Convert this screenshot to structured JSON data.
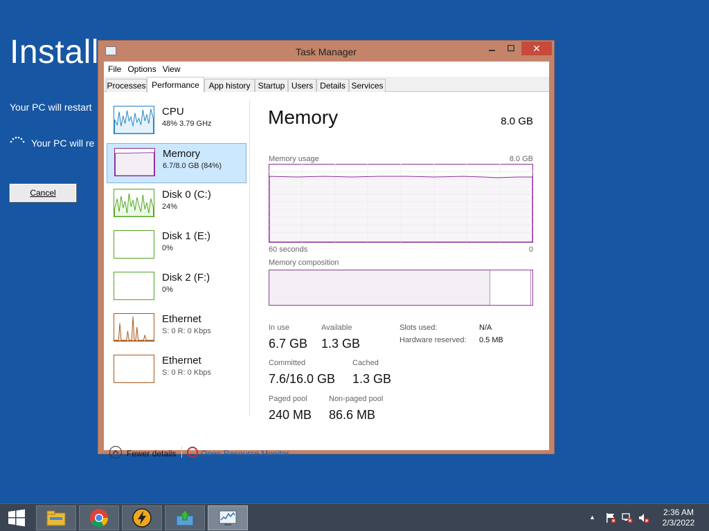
{
  "installer": {
    "title": "Install",
    "line1": "Your PC will restart",
    "line2": "Your PC will re",
    "cancel_label": "Cancel"
  },
  "window": {
    "title": "Task Manager",
    "close_glyph": "✕"
  },
  "menu": [
    "File",
    "Options",
    "View"
  ],
  "tabs": [
    {
      "label": "Processes",
      "active": false
    },
    {
      "label": "Performance",
      "active": true
    },
    {
      "label": "App history",
      "active": false
    },
    {
      "label": "Startup",
      "active": false
    },
    {
      "label": "Users",
      "active": false
    },
    {
      "label": "Details",
      "active": false
    },
    {
      "label": "Services",
      "active": false
    }
  ],
  "perf_list": [
    {
      "name": "CPU",
      "sub": "48% 3.79 GHz",
      "color": "#1b82c5"
    },
    {
      "name": "Memory",
      "sub": "6.7/8.0 GB (84%)",
      "color": "#8b2a9b"
    },
    {
      "name": "Disk 0 (C:)",
      "sub": "24%",
      "color": "#4da41c"
    },
    {
      "name": "Disk 1 (E:)",
      "sub": "0%",
      "color": "#4da41c"
    },
    {
      "name": "Disk 2 (F:)",
      "sub": "0%",
      "color": "#4da41c"
    },
    {
      "name": "Ethernet",
      "sub": "S: 0  R: 0 Kbps",
      "color": "#a7571b"
    },
    {
      "name": "Ethernet",
      "sub": "S: 0  R: 0 Kbps",
      "color": "#a7571b"
    }
  ],
  "memory": {
    "title": "Memory",
    "total": "8.0 GB",
    "usage_label": "Memory usage",
    "usage_max": "8.0 GB",
    "time_label": "60 seconds",
    "time_min": "0",
    "composition_label": "Memory composition",
    "in_use_fraction": 0.84,
    "stats": {
      "in_use_label": "In use",
      "in_use": "6.7 GB",
      "available_label": "Available",
      "available": "1.3 GB",
      "committed_label": "Committed",
      "committed": "7.6/16.0 GB",
      "cached_label": "Cached",
      "cached": "1.3 GB",
      "paged_label": "Paged pool",
      "paged": "240 MB",
      "nonpaged_label": "Non-paged pool",
      "nonpaged": "86.6 MB",
      "slots_label": "Slots used:",
      "slots": "N/A",
      "hwres_label": "Hardware reserved:",
      "hwres": "0.5 MB"
    }
  },
  "footer": {
    "fewer_details": "Fewer details",
    "resource_monitor": "Open Resource Monitor"
  },
  "taskbar": {
    "apps": [
      "file-explorer",
      "chrome",
      "power-app",
      "installer-app",
      "task-manager"
    ],
    "time": "2:36 AM",
    "date": "2/3/2022",
    "up_arrow": "▲"
  },
  "colors": {
    "desktop": "#1756a3",
    "window_frame": "#c4846a",
    "memory_accent": "#8b2a9b"
  }
}
